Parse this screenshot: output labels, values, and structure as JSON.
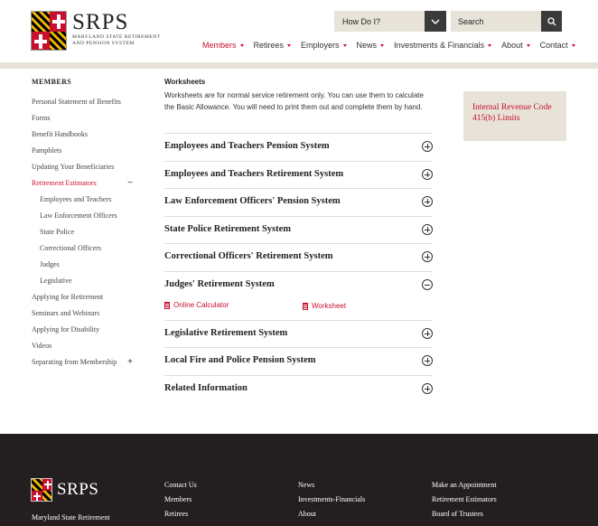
{
  "header": {
    "logo_text": "SRPS",
    "logo_sub_line1": "MARYLAND STATE RETIREMENT",
    "logo_sub_line2": "and PENSION SYSTEM",
    "howdoi_label": "How Do I?",
    "search_placeholder": "Search",
    "nav": [
      {
        "label": "Members",
        "active": true
      },
      {
        "label": "Retirees"
      },
      {
        "label": "Employers"
      },
      {
        "label": "News"
      },
      {
        "label": "Investments & Financials"
      },
      {
        "label": "About"
      },
      {
        "label": "Contact"
      }
    ]
  },
  "sidebar": {
    "heading": "MEMBERS",
    "items": [
      {
        "label": "Personal Statement of Benefits"
      },
      {
        "label": "Forms"
      },
      {
        "label": "Benefit Handbooks"
      },
      {
        "label": "Pamphlets"
      },
      {
        "label": "Updating Your Beneficiaries"
      },
      {
        "label": "Retirement Estimators",
        "toggle": "−"
      },
      {
        "label": "Employees and Teachers"
      },
      {
        "label": "Law Enforcement Officers"
      },
      {
        "label": "State Police"
      },
      {
        "label": "Correctional Officers"
      },
      {
        "label": "Judges"
      },
      {
        "label": "Legislative"
      },
      {
        "label": "Applying for Retirement"
      },
      {
        "label": "Seminars and Webinars"
      },
      {
        "label": "Applying for Disability"
      },
      {
        "label": "Videos"
      },
      {
        "label": "Separating from Membership",
        "toggle": "+"
      }
    ]
  },
  "main": {
    "title": "Worksheets",
    "description": "Worksheets are for normal service retirement only. You can use them to calculate the Basic Allowance. You will need to print them out and complete them by hand.",
    "accordion": [
      {
        "title": "Employees and Teachers Pension System"
      },
      {
        "title": "Employees and Teachers Retirement System"
      },
      {
        "title": "Law Enforcement Officers' Pension System"
      },
      {
        "title": "State Police Retirement System"
      },
      {
        "title": "Correctional Officers' Retirement System"
      },
      {
        "title": "Judges' Retirement System",
        "links": [
          "Online Calculator",
          "Worksheet"
        ]
      },
      {
        "title": "Legislative Retirement System"
      },
      {
        "title": "Local Fire and Police Pension System"
      },
      {
        "title": "Related Information"
      }
    ]
  },
  "aside": {
    "irs_label": "Internal Revenue Code 415(b) Limits"
  },
  "footer": {
    "logo_text": "SRPS",
    "org_name": "Maryland State Retirement",
    "col1": [
      "Contact Us",
      "Members",
      "Retirees"
    ],
    "col2": [
      "News",
      "Investments-Financials",
      "About"
    ],
    "col3": [
      "Make an Appointment",
      "Retirement Estimators",
      "Board of Trustees"
    ]
  },
  "colors": {
    "accent": "#c8102e",
    "sand": "#e7e3d8",
    "footer_bg": "#231f20"
  }
}
